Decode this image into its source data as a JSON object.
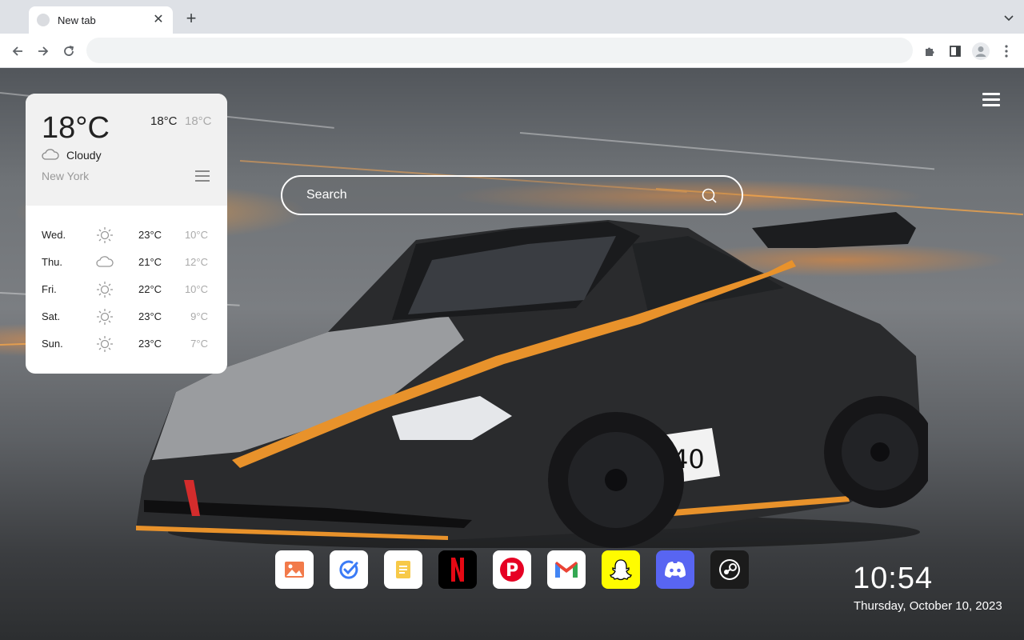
{
  "browser": {
    "tab_title": "New tab",
    "omnibox_value": ""
  },
  "weather": {
    "current_temp": "18°C",
    "high": "18°C",
    "low": "18°C",
    "condition": "Cloudy",
    "city": "New York",
    "forecast": [
      {
        "day": "Wed.",
        "icon": "sun-icon",
        "high": "23°C",
        "low": "10°C"
      },
      {
        "day": "Thu.",
        "icon": "cloud-icon",
        "high": "21°C",
        "low": "12°C"
      },
      {
        "day": "Fri.",
        "icon": "sun-icon",
        "high": "22°C",
        "low": "10°C"
      },
      {
        "day": "Sat.",
        "icon": "sun-icon",
        "high": "23°C",
        "low": "9°C"
      },
      {
        "day": "Sun.",
        "icon": "sun-icon",
        "high": "23°C",
        "low": "7°C"
      }
    ]
  },
  "search": {
    "placeholder": "Search"
  },
  "dock": {
    "apps": [
      {
        "name": "photos-app-icon",
        "color": "#ffffff"
      },
      {
        "name": "todo-app-icon",
        "color": "#ffffff"
      },
      {
        "name": "notes-app-icon",
        "color": "#ffffff"
      },
      {
        "name": "netflix-app-icon",
        "color": "#000000"
      },
      {
        "name": "pinterest-app-icon",
        "color": "#ffffff"
      },
      {
        "name": "gmail-app-icon",
        "color": "#ffffff"
      },
      {
        "name": "snapchat-app-icon",
        "color": "#fffc00"
      },
      {
        "name": "discord-app-icon",
        "color": "#5865f2"
      },
      {
        "name": "steam-app-icon",
        "color": "#1b1b1b"
      }
    ]
  },
  "clock": {
    "time": "10:54",
    "date": "Thursday, October 10, 2023"
  }
}
